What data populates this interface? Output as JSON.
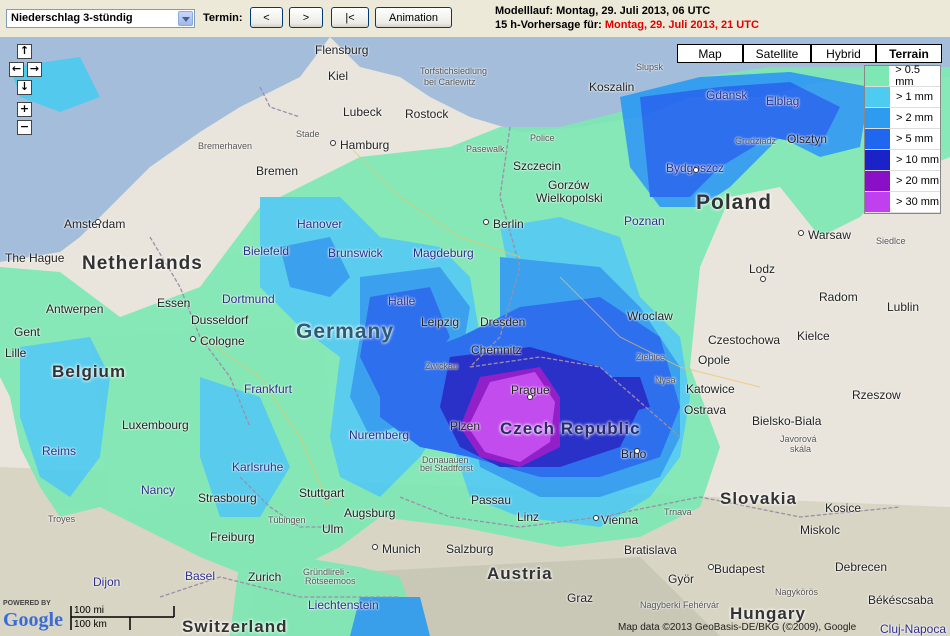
{
  "toolbar": {
    "product": "Niederschlag 3-stündig",
    "termin_label": "Termin:",
    "prev_label": "<",
    "next_label": ">",
    "first_label": "|<",
    "animation_label": "Animation",
    "model_run_label": "Modelllauf:",
    "model_run_value": "Montag, 29. Juli 2013, 06 UTC",
    "forecast_label": "15 h-Vorhersage für:",
    "forecast_value": "Montag, 29. Juli 2013, 21 UTC"
  },
  "map_types": [
    "Map",
    "Satellite",
    "Hybrid",
    "Terrain"
  ],
  "active_map_type": "Terrain",
  "legend": [
    {
      "label": "> 0.5 mm",
      "color": "#7ee8b4"
    },
    {
      "label": "> 1 mm",
      "color": "#4ecbf0"
    },
    {
      "label": "> 2 mm",
      "color": "#2d9cf0"
    },
    {
      "label": "> 5 mm",
      "color": "#1f66f0"
    },
    {
      "label": "> 10 mm",
      "color": "#1a22c8"
    },
    {
      "label": "> 20 mm",
      "color": "#8a10c8"
    },
    {
      "label": "> 30 mm",
      "color": "#c040f0"
    }
  ],
  "countries": {
    "netherlands": "Netherlands",
    "germany": "Germany",
    "poland": "Poland",
    "belgium": "Belgium",
    "czech": "Czech Republic",
    "slovakia": "Slovakia",
    "austria": "Austria",
    "hungary": "Hungary",
    "switzerland": "Switzerland"
  },
  "cities": {
    "flensburg": "Flensburg",
    "kiel": "Kiel",
    "torfstich": "Torfstichsiedlung",
    "carlewitz": "bei Carlewitz",
    "lubeck": "Lubeck",
    "rostock": "Rostock",
    "stade": "Stade",
    "hamburg": "Hamburg",
    "bremerhaven": "Bremerhaven",
    "pasewalk": "Pasewalk",
    "police": "Police",
    "szczecin": "Szczecin",
    "koszalin": "Koszalin",
    "slupsk": "Slupsk",
    "gdansk": "Gdansk",
    "elblag": "Elblag",
    "grudziadz": "Grudziadz",
    "olsztyn": "Olsztyn",
    "bydgoszcz": "Bydgoszcz",
    "bremen": "Bremen",
    "gorzow": "Gorzów",
    "wielkopolski": "Wielkopolski",
    "poznan": "Poznan",
    "amsterdam": "Amsterdam",
    "hanover": "Hanover",
    "brunswick": "Brunswick",
    "magdeburg": "Magdeburg",
    "berlin": "Berlin",
    "warsaw": "Warsaw",
    "siedlce": "Siedlce",
    "hague": "The Hague",
    "bielefeld": "Bielefeld",
    "lodz": "Lodz",
    "radom": "Radom",
    "dortmund": "Dortmund",
    "halle": "Halle",
    "lublin": "Lublin",
    "antwerpen": "Antwerpen",
    "essen": "Essen",
    "dusseldorf": "Dusseldorf",
    "leipzig": "Leipzig",
    "dresden": "Dresden",
    "wroclaw": "Wroclaw",
    "gent": "Gent",
    "cologne": "Cologne",
    "czestochowa": "Czestochowa",
    "kielce": "Kielce",
    "lille": "Lille",
    "chemnitz": "Chemnitz",
    "zwickau": "Zwickau",
    "ziebice": "Ziebice",
    "opole": "Opole",
    "prague": "Prague",
    "nysa": "Nysa",
    "katowice": "Katowice",
    "rzeszow": "Rzeszow",
    "frankfurt": "Frankfurt",
    "ostrava": "Ostrava",
    "bielsko": "Bielsko-Biala",
    "luxembourg": "Luxembourg",
    "plzen": "Plzen",
    "javorova": "Javorová",
    "skala": "skála",
    "nuremberg": "Nuremberg",
    "brno": "Brno",
    "donauauen": "Donauauen",
    "stadtforst": "bei Stadtforst",
    "reims": "Reims",
    "karlsruhe": "Karlsruhe",
    "nancy": "Nancy",
    "stuttgart": "Stuttgart",
    "passau": "Passau",
    "strasbourg": "Strasbourg",
    "trnava": "Trnava",
    "kosice": "Kosice",
    "augsburg": "Augsburg",
    "linz": "Linz",
    "troyes": "Troyes",
    "tubingen": "Tübingen",
    "ulm": "Ulm",
    "vienna": "Vienna",
    "miskolc": "Miskolc",
    "freiburg": "Freiburg",
    "bratislava": "Bratislava",
    "munich": "Munich",
    "salzburg": "Salzburg",
    "debrecen": "Debrecen",
    "basel": "Basel",
    "zurich": "Zurich",
    "grundlireli": "Gründlireli -",
    "rotseemoos": "Rötseemoos",
    "budapest": "Budapest",
    "dijon": "Dijon",
    "gyor": "Györ",
    "graz": "Graz",
    "nagykoros": "Nagykörös",
    "liechtenstein": "Liechtenstein",
    "bekescsaba": "Békéscsaba",
    "nagyberki": "Nagyberki Fehérvár",
    "cluj": "Cluj-Napoca"
  },
  "copyright": "Map data ©2013 GeoBasis-DE/BKG (©2009), Google",
  "powered_by": "POWERED BY",
  "google": "Google",
  "scale": {
    "mi": "100 mi",
    "km": "100 km"
  }
}
